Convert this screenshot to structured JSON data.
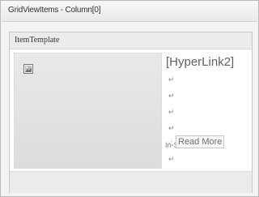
{
  "window": {
    "title": "GridViewItems - Column[0]"
  },
  "template": {
    "label": "ItemTemplate",
    "image_icon": "broken-image-icon",
    "hyperlink_text": "[HyperLink2]",
    "paragraph_mark": "↵",
    "in_stock_text": "In-Stock: ·↵",
    "read_more_label": "Read More",
    "read_more_prefix": "·:"
  }
}
